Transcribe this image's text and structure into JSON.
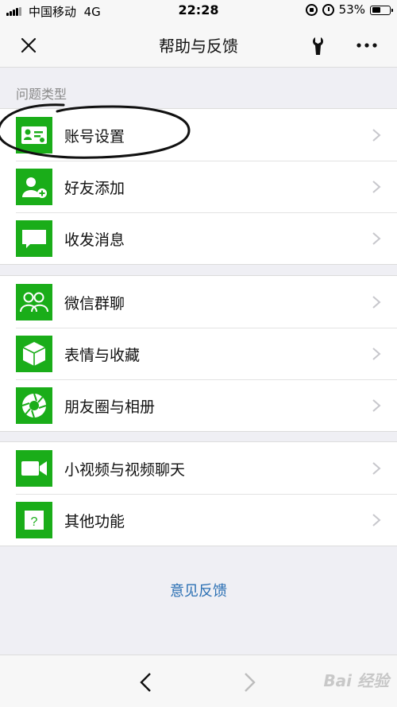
{
  "status_bar": {
    "carrier": "中国移动",
    "network": "4G",
    "time": "22:28",
    "battery_text": "53%",
    "battery_level": 0.53,
    "icons": [
      "signal-icon",
      "rotation-lock-icon",
      "alarm-icon",
      "battery-icon"
    ]
  },
  "nav": {
    "title": "帮助与反馈",
    "icons": [
      "close-icon",
      "wrench-icon",
      "more-icon"
    ]
  },
  "section_label": "问题类型",
  "groups": [
    [
      {
        "label": "账号设置",
        "icon": "account-card-icon"
      },
      {
        "label": "好友添加",
        "icon": "add-friend-icon"
      },
      {
        "label": "收发消息",
        "icon": "message-icon"
      }
    ],
    [
      {
        "label": "微信群聊",
        "icon": "group-chat-icon"
      },
      {
        "label": "表情与收藏",
        "icon": "sticker-box-icon"
      },
      {
        "label": "朋友圈与相册",
        "icon": "moments-aperture-icon"
      }
    ],
    [
      {
        "label": "小视频与视频聊天",
        "icon": "video-camera-icon"
      },
      {
        "label": "其他功能",
        "icon": "question-icon"
      }
    ]
  ],
  "feedback_link": "意见反馈",
  "bottom_bar": {
    "watermark": "Bai 经验",
    "icons": [
      "back-arrow-icon",
      "forward-arrow-icon"
    ]
  },
  "colors": {
    "accent_green": "#1aad19",
    "link_blue": "#2a6fb3",
    "background": "#efeff4"
  }
}
